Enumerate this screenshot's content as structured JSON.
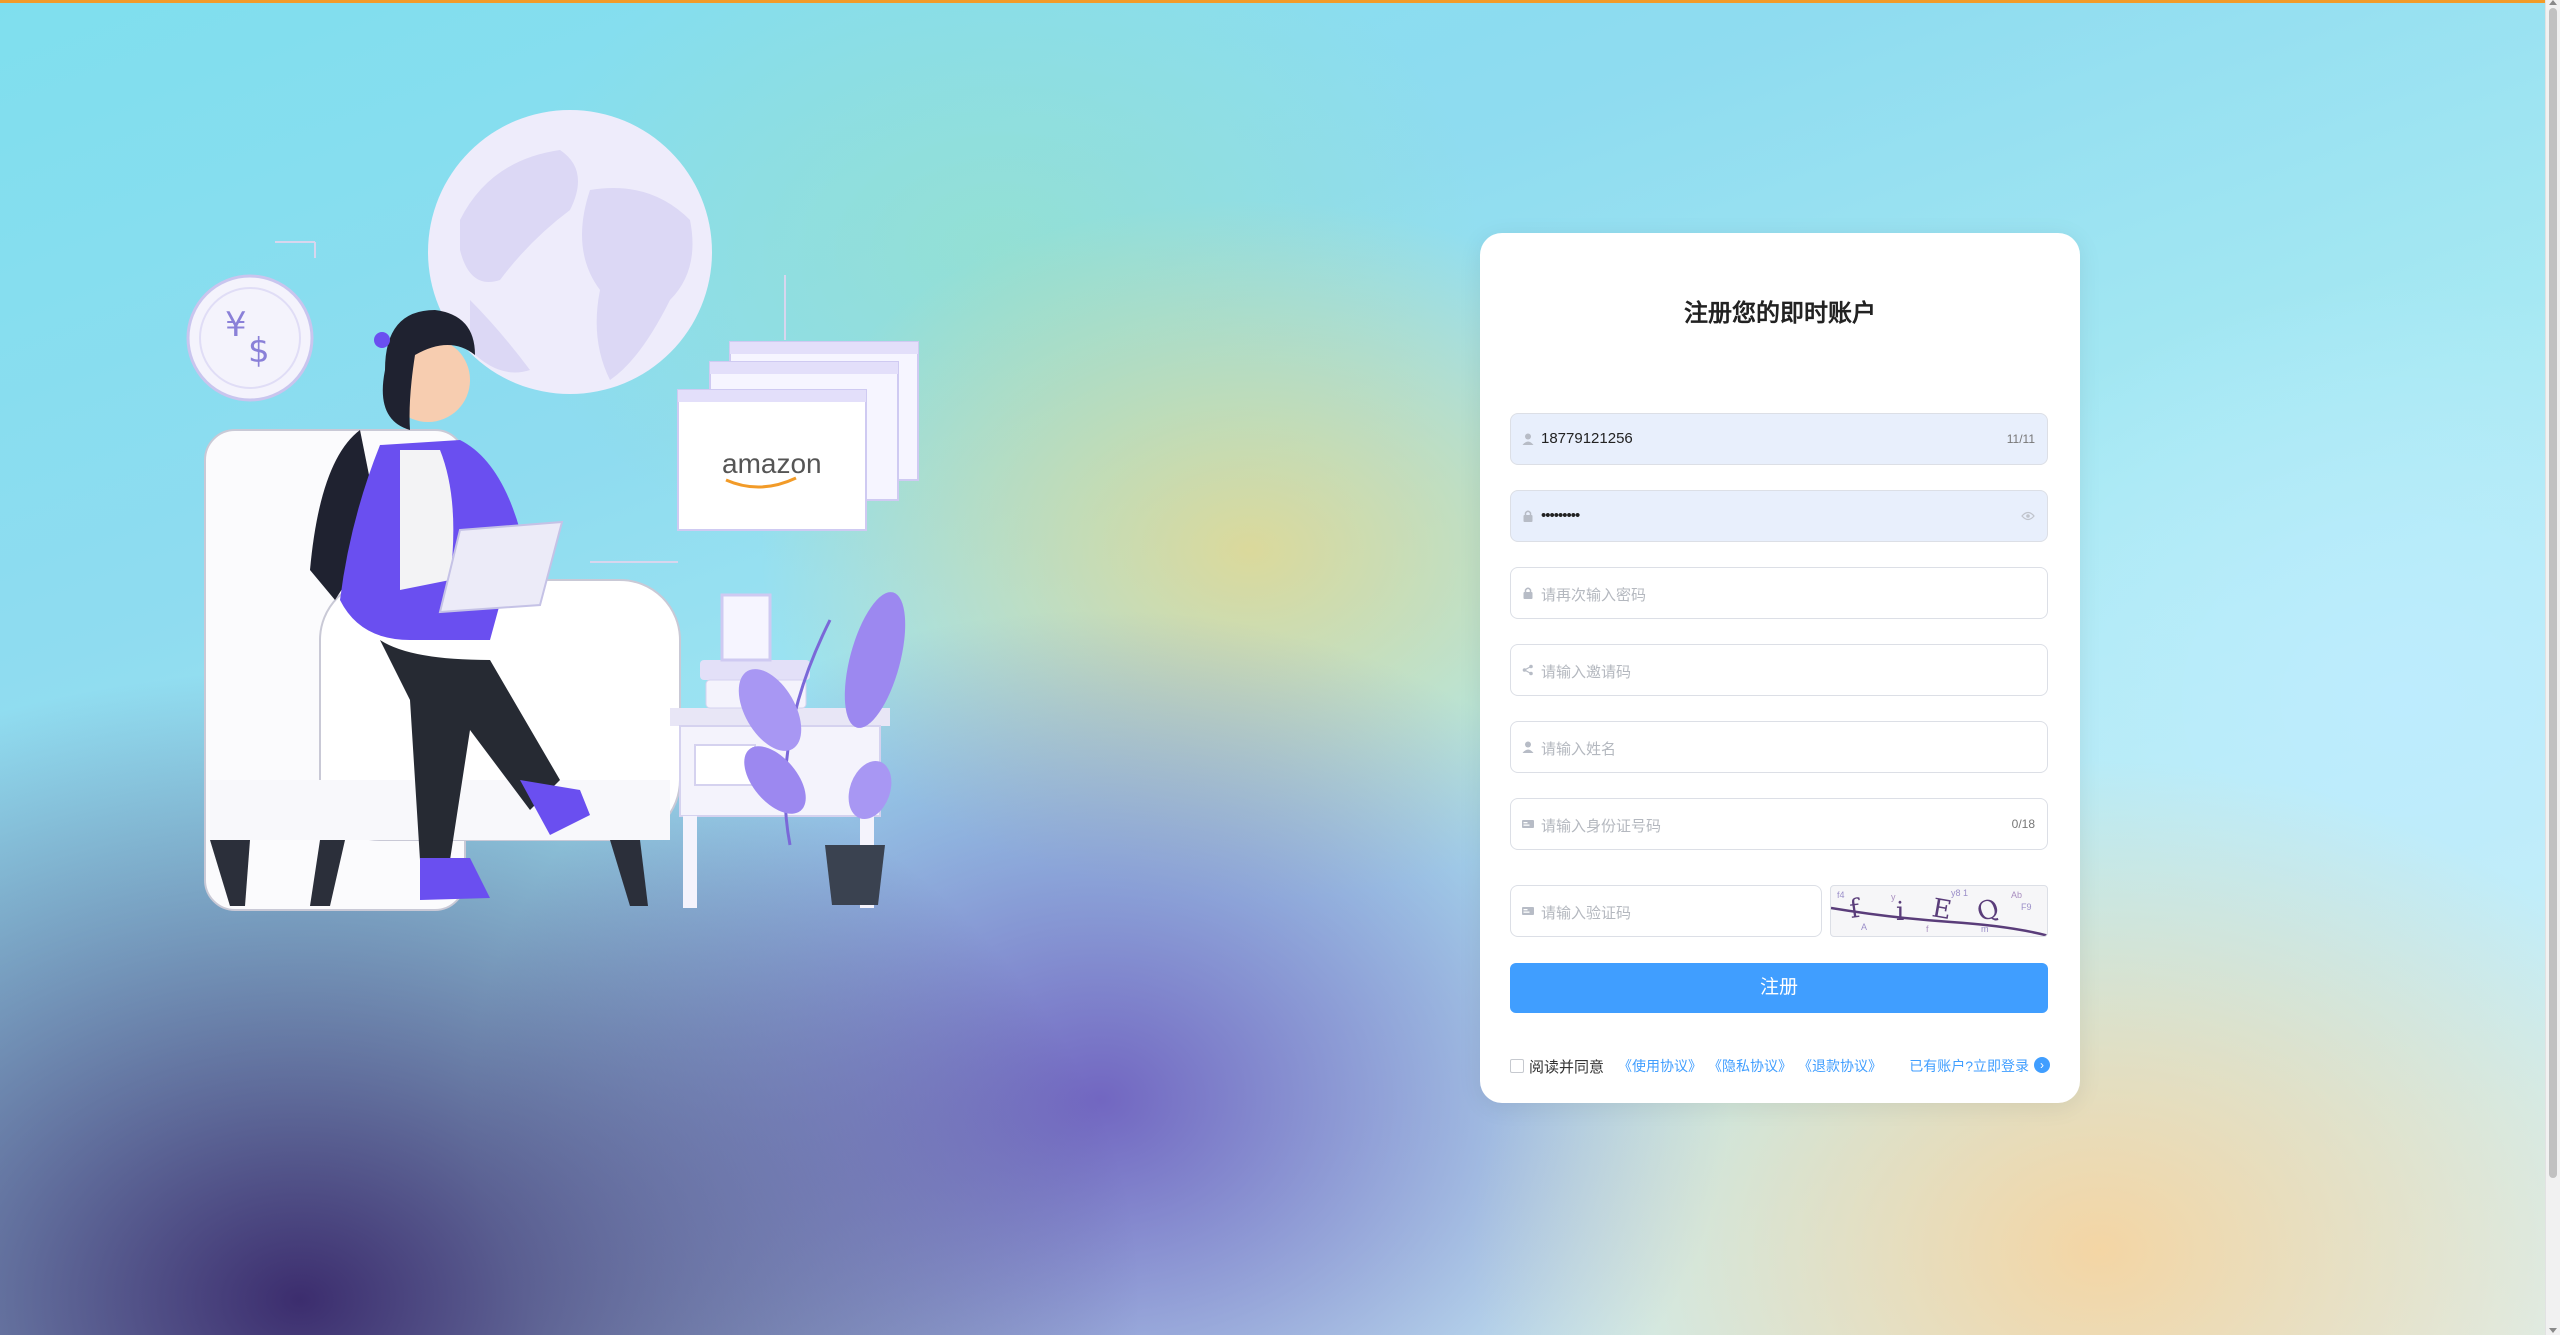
{
  "form": {
    "title": "注册您的即时账户",
    "phone": {
      "value": "18779121256",
      "counter": "11/11",
      "icon": "user-icon"
    },
    "password": {
      "value": "•••••••••",
      "icon": "lock-icon",
      "toggle_icon": "eye-icon"
    },
    "confirm_password": {
      "placeholder": "请再次输入密码",
      "icon": "lock-icon"
    },
    "invite_code": {
      "placeholder": "请输入邀请码",
      "icon": "share-icon"
    },
    "name": {
      "placeholder": "请输入姓名",
      "icon": "user-icon"
    },
    "id_number": {
      "placeholder": "请输入身份证号码",
      "counter": "0/18",
      "icon": "id-card-icon"
    },
    "captcha": {
      "placeholder": "请输入验证码",
      "icon": "id-card-icon",
      "image_text": "fiEQ"
    },
    "submit_label": "注册",
    "agreement": {
      "prefix": "阅读并同意",
      "links": [
        "《使用协议》",
        "《隐私协议》",
        "《退款协议》"
      ],
      "login_text": "已有账户?立即登录",
      "login_icon": "chevron-right-circle-icon"
    }
  },
  "illustration": {
    "logo_text": "amazon",
    "currency_icon": "currency-exchange-icon"
  },
  "colors": {
    "primary": "#409eff",
    "top_accent": "#f29b28",
    "input_filled_bg": "#e8effc"
  }
}
